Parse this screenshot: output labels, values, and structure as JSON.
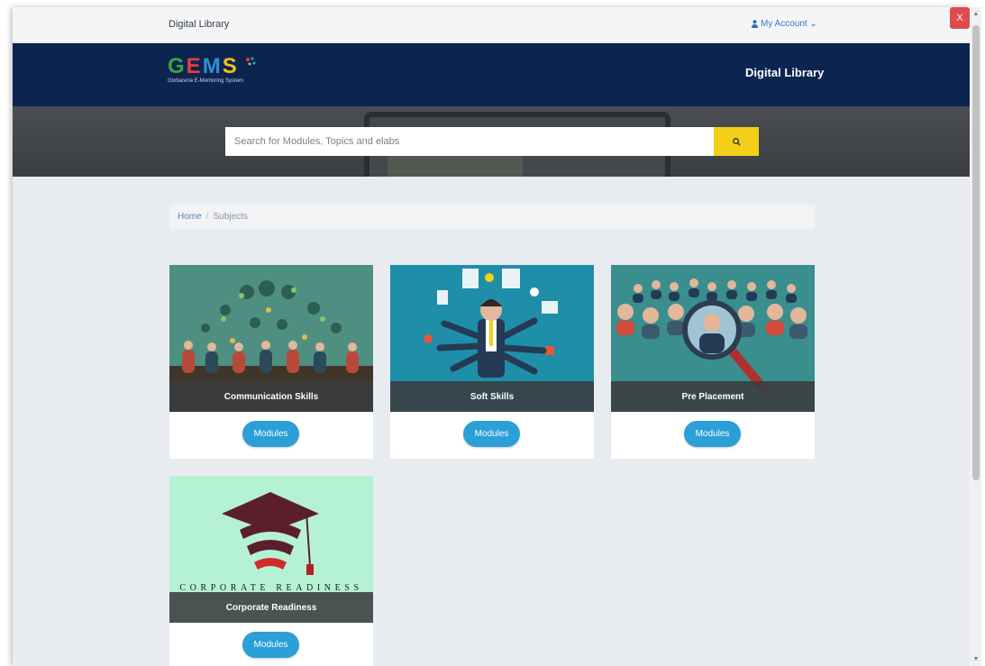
{
  "topbar": {
    "brand": "Digital Library",
    "account_label": "My Account"
  },
  "header": {
    "logo_letters": [
      "G",
      "E",
      "M",
      "S"
    ],
    "logo_tagline": "Globarena E-Mentoring System",
    "title": "Digital Library"
  },
  "search": {
    "placeholder": "Search for Modules, Topics and elabs"
  },
  "breadcrumb": {
    "home": "Home",
    "separator": "/",
    "current": "Subjects"
  },
  "cards": [
    {
      "title": "Communication Skills",
      "button": "Modules",
      "icon": "people-chat-illustration"
    },
    {
      "title": "Soft Skills",
      "button": "Modules",
      "icon": "multitasking-man-illustration"
    },
    {
      "title": "Pre Placement",
      "button": "Modules",
      "icon": "magnifier-candidates-illustration"
    },
    {
      "title": "Corporate Readiness",
      "button": "Modules",
      "icon": "graduation-cap-illustration",
      "image_text": "CORPORATE READINESS"
    }
  ],
  "close_label": "X",
  "colors": {
    "header_bg": "#0c2450",
    "search_button": "#f2cf18",
    "module_button": "#2a9fd8",
    "close_button": "#e04b4b",
    "logo": [
      "#3aa53b",
      "#e83d3d",
      "#2f8fd6",
      "#f3c11a"
    ]
  }
}
